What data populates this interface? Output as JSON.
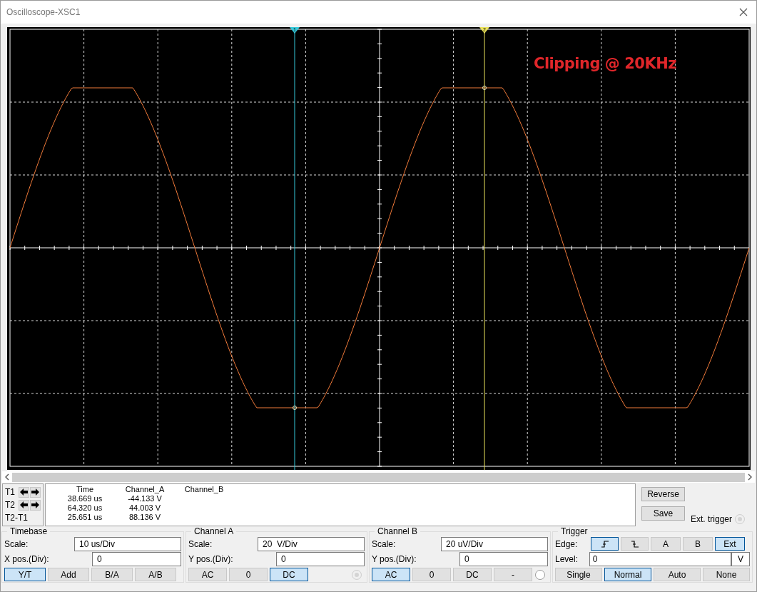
{
  "window": {
    "title": "Oscilloscope-XSC1"
  },
  "screen": {
    "annotation": "Clipping @ 20KHz",
    "cursors": [
      {
        "label": "1",
        "color": "#35c9da"
      },
      {
        "label": "2",
        "color": "#ece35a"
      }
    ]
  },
  "readout": {
    "columns": [
      "Time",
      "Channel_A",
      "Channel_B"
    ],
    "rows": [
      {
        "label": "T1",
        "kind": "cursor",
        "cells": [
          "38.669 us",
          "-44.133 V"
        ]
      },
      {
        "label": "T2",
        "kind": "cursor",
        "cells": [
          "64.320 us",
          "44.003 V"
        ]
      },
      {
        "label": "T2-T1",
        "kind": "difference",
        "cells": [
          "25.651 us",
          "88.136 V"
        ]
      }
    ]
  },
  "side_buttons": [
    "Reverse",
    "Save"
  ],
  "ext_trigger": {
    "label": "Ext. trigger",
    "disabled": true
  },
  "timebase": {
    "title": "Timebase",
    "fields": [
      {
        "label": "Scale:",
        "value": "10 us/Div"
      },
      {
        "label": "X pos.(Div):",
        "value": "0"
      }
    ],
    "buttons": [
      {
        "label": "Y/T",
        "selected": true
      },
      {
        "label": "Add",
        "selected": false
      },
      {
        "label": "B/A",
        "selected": false
      },
      {
        "label": "A/B",
        "selected": false
      }
    ]
  },
  "channels": [
    {
      "title": "Channel A",
      "fields": [
        {
          "label": "Scale:",
          "value": "20  V/Div"
        },
        {
          "label": "Y pos.(Div):",
          "value": "0"
        }
      ],
      "radio_disabled": true,
      "buttons": [
        {
          "label": "AC",
          "selected": false
        },
        {
          "label": "0",
          "selected": false
        },
        {
          "label": "DC",
          "selected": true
        }
      ]
    },
    {
      "title": "Channel B",
      "fields": [
        {
          "label": "Scale:",
          "value": "20 uV/Div"
        },
        {
          "label": "Y pos.(Div):",
          "value": "0"
        }
      ],
      "radio_disabled": false,
      "buttons": [
        {
          "label": "AC",
          "selected": true
        },
        {
          "label": "0",
          "selected": false
        },
        {
          "label": "DC",
          "selected": false
        },
        {
          "label": "-",
          "selected": false
        }
      ]
    }
  ],
  "trigger": {
    "title": "Trigger",
    "edge_label": "Edge:",
    "edges": [
      {
        "kind": "rising",
        "selected": true
      },
      {
        "kind": "falling",
        "selected": false
      },
      {
        "kind": "text",
        "label": "A",
        "selected": false
      },
      {
        "kind": "text",
        "label": "B",
        "selected": false
      },
      {
        "kind": "text",
        "label": "Ext",
        "selected": true
      }
    ],
    "level_label": "Level:",
    "level_value": "0",
    "level_unit": "V",
    "modes": [
      {
        "label": "Single",
        "selected": false
      },
      {
        "label": "Normal",
        "selected": true
      },
      {
        "label": "Auto",
        "selected": false
      },
      {
        "label": "None",
        "selected": false
      }
    ]
  }
}
